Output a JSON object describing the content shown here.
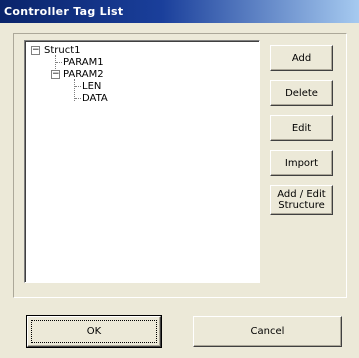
{
  "window": {
    "title": "Controller Tag List"
  },
  "tree": {
    "nodes": [
      {
        "label": "Struct1",
        "expanded": true
      },
      {
        "label": "PARAM1"
      },
      {
        "label": "PARAM2",
        "expanded": true
      },
      {
        "label": "LEN"
      },
      {
        "label": "DATA"
      }
    ]
  },
  "buttons": {
    "add": "Add",
    "delete": "Delete",
    "edit": "Edit",
    "import": "Import",
    "add_edit_structure": "Add / Edit\nStructure",
    "ok": "OK",
    "cancel": "Cancel"
  },
  "icons": {
    "collapse": "minus-box-icon"
  }
}
